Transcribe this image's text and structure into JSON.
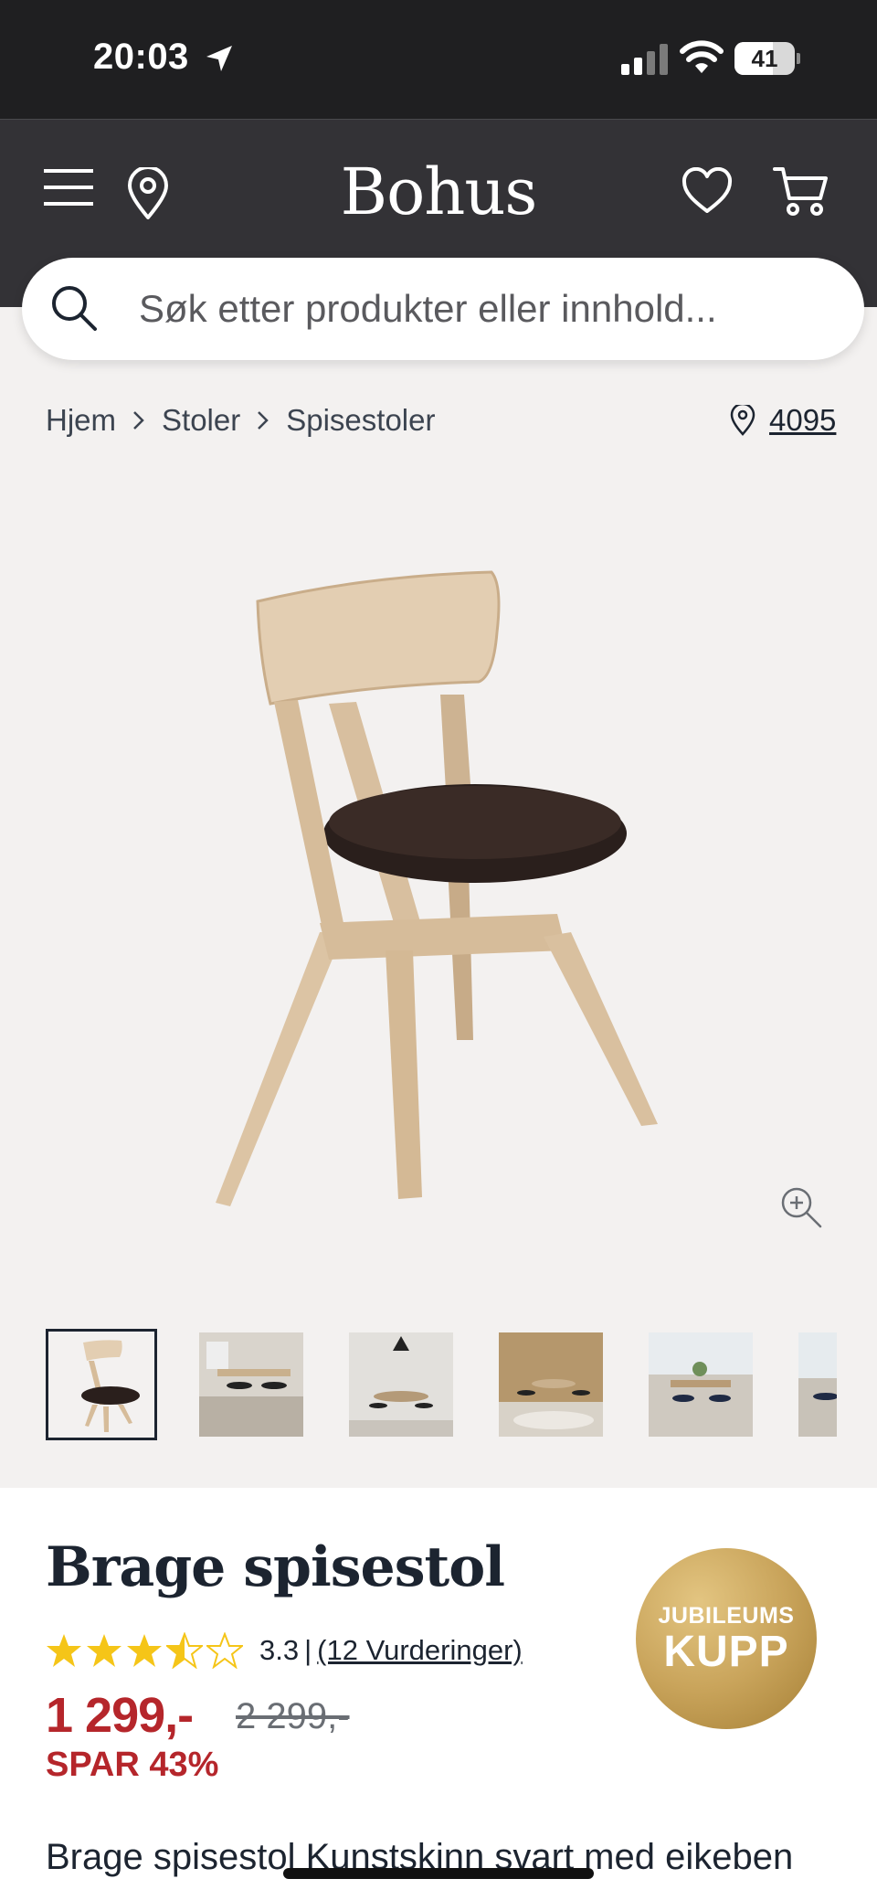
{
  "status_bar": {
    "time": "20:03",
    "battery": "41"
  },
  "header": {
    "brand": "Bohus",
    "icons": [
      "menu-icon",
      "location-pin-icon",
      "heart-icon",
      "cart-icon"
    ]
  },
  "search": {
    "placeholder": "Søk etter produkter eller innhold..."
  },
  "breadcrumb": {
    "items": [
      "Hjem",
      "Stoler",
      "Spisestoler"
    ],
    "store": "4095"
  },
  "gallery": {
    "thumbnail_count": 6,
    "selected_index": 0
  },
  "product": {
    "title": "Brage spisestol",
    "rating": {
      "value": "3.3",
      "stars": 3.3,
      "max": 5,
      "separator": "|",
      "count_label": "(12 Vurderinger)"
    },
    "price": "1 299,-",
    "old_price": "2 299,-",
    "save_label": "SPAR 43%",
    "badge": {
      "line1": "JUBILEUMS",
      "line2": "KUPP"
    },
    "description": {
      "prefix": "Brage spisestol ",
      "link": "Kunstskinn svart ",
      "suffix": "med eikeben"
    }
  },
  "colors": {
    "header_bg": "#333236",
    "price_red": "#b5262b",
    "gold": "#c9a45b",
    "star": "#f5c518"
  }
}
